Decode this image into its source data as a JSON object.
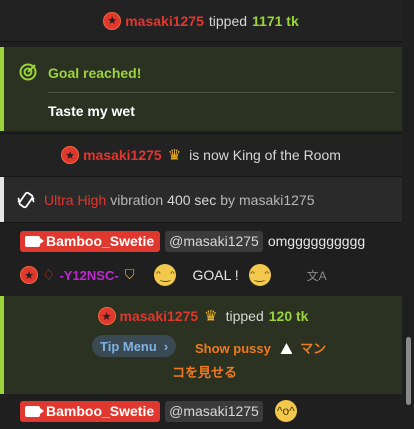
{
  "tip1": {
    "user": "masaki1275",
    "text": "tipped",
    "amount": "1171 tk"
  },
  "goal": {
    "heading": "Goal reached!",
    "subject": "Taste my wet"
  },
  "king": {
    "user": "masaki1275",
    "text": "is now King of the Room"
  },
  "vibe": {
    "level": "Ultra High",
    "kind": "vibration",
    "duration": "400 sec",
    "by": "by",
    "user": "masaki1275"
  },
  "msg1": {
    "user": "Bamboo_Swetie",
    "mention": "@masaki1275",
    "text": "omgggggggggg"
  },
  "msg2": {
    "user": "-Y12NSC-",
    "text": "GOAL !"
  },
  "tip2": {
    "user": "masaki1275",
    "text": "tipped",
    "amount": "120 tk",
    "menu_label": "Tip Menu",
    "item_line1": "Show pussy",
    "item_jp1": "マン",
    "item_line2": "コを見せる"
  },
  "msg3": {
    "user": "Bamboo_Swetie",
    "mention": "@masaki1275"
  },
  "colors": {
    "accent_red": "#e0372f",
    "goal_green": "#9ad43a",
    "tip_bg": "#2b3222",
    "crown": "#f0b429"
  }
}
